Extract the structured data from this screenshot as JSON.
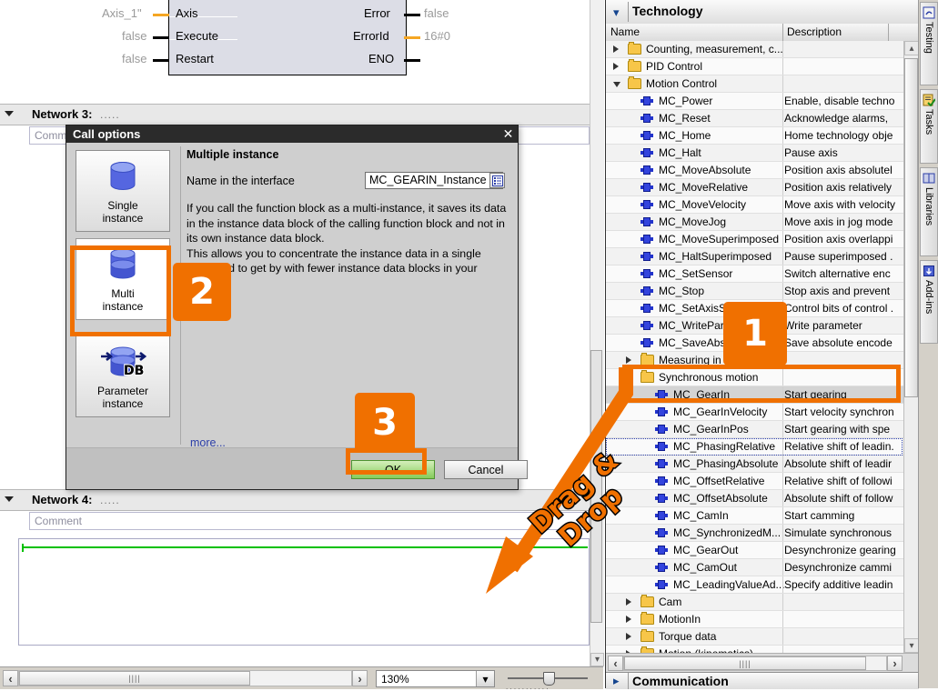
{
  "fbd": {
    "inputs": [
      {
        "value": "Axis_1\"",
        "label": "Axis",
        "wire": "orange"
      },
      {
        "value": "false",
        "label": "Execute",
        "wire": "black"
      },
      {
        "value": "false",
        "label": "Restart",
        "wire": "black"
      }
    ],
    "outputs": [
      {
        "label": "Error",
        "value": "false",
        "wire": "black"
      },
      {
        "label": "ErrorId",
        "value": "16#0",
        "wire": "orange"
      },
      {
        "label": "ENO",
        "value": "",
        "wire": "black"
      }
    ]
  },
  "networks": [
    {
      "title": "Network 3:",
      "dots": "....."
    },
    {
      "title": "Network 4:",
      "dots": ".....",
      "comment": "Comment"
    }
  ],
  "network3_comment": "Comm",
  "dialog": {
    "title": "Call options",
    "close_icon": "close-icon",
    "instance_options": [
      {
        "label_line1": "Single",
        "label_line2": "instance",
        "icon": "single-db-cylinder-icon",
        "selected": false
      },
      {
        "label_line1": "Multi",
        "label_line2": "instance",
        "icon": "multi-db-cylinder-icon",
        "selected": true
      },
      {
        "label_line1": "Parameter",
        "label_line2": "instance",
        "icon": "parameter-db-icon",
        "selected": false
      }
    ],
    "heading": "Multiple instance",
    "name_label": "Name in the interface",
    "name_value": "MC_GEARIN_Instance",
    "name_placeholder": "MC_GEARIN_Instance",
    "name_browse_icon": "list-browse-icon",
    "description": "If you call the function block as a multi-instance, it saves its data in the instance data block of the calling function block and not in its own instance data block.\nThis allows you to concentrate the instance data in a single block and to get by with fewer instance data blocks in your",
    "more_link": "more...",
    "ok_label": "OK",
    "cancel_label": "Cancel"
  },
  "badges": [
    {
      "number": "1"
    },
    {
      "number": "2"
    },
    {
      "number": "3"
    }
  ],
  "annotation": {
    "drag_line1": "Drag &",
    "drag_line2": "Drop",
    "accent_color": "#f07000"
  },
  "toolbar": {
    "zoom_value": "130%",
    "zoom_dropdown_icon": "chevron-down-icon",
    "scroll_left_icon": "chevron-left-icon",
    "scroll_right_icon": "chevron-right-icon"
  },
  "right_panel": {
    "header_title": "Technology",
    "header_chevron": "chevron-down-icon",
    "columns": [
      "Name",
      "Description"
    ],
    "bottom_title": "Communication",
    "bottom_chevron": "chevron-right-icon",
    "rows": [
      {
        "name": "Counting, measurement, c...",
        "desc": "",
        "type": "folder",
        "indent": 0,
        "expander": "closed"
      },
      {
        "name": "PID Control",
        "desc": "",
        "type": "folder",
        "indent": 0,
        "expander": "closed"
      },
      {
        "name": "Motion Control",
        "desc": "",
        "type": "folder",
        "indent": 0,
        "expander": "open"
      },
      {
        "name": "MC_Power",
        "desc": "Enable, disable techno",
        "type": "fb",
        "indent": 1
      },
      {
        "name": "MC_Reset",
        "desc": "Acknowledge alarms,",
        "type": "fb",
        "indent": 1
      },
      {
        "name": "MC_Home",
        "desc": "Home technology obje",
        "type": "fb",
        "indent": 1
      },
      {
        "name": "MC_Halt",
        "desc": "Pause axis",
        "type": "fb",
        "indent": 1
      },
      {
        "name": "MC_MoveAbsolute",
        "desc": "Position axis absolutel",
        "type": "fb",
        "indent": 1
      },
      {
        "name": "MC_MoveRelative",
        "desc": "Position axis relatively",
        "type": "fb",
        "indent": 1
      },
      {
        "name": "MC_MoveVelocity",
        "desc": "Move axis with velocity",
        "type": "fb",
        "indent": 1
      },
      {
        "name": "MC_MoveJog",
        "desc": "Move axis in jog mode",
        "type": "fb",
        "indent": 1
      },
      {
        "name": "MC_MoveSuperimposed",
        "desc": "Position axis overlappi",
        "type": "fb",
        "indent": 1
      },
      {
        "name": "MC_HaltSuperimposed",
        "desc": "Pause superimposed .",
        "type": "fb",
        "indent": 1
      },
      {
        "name": "MC_SetSensor",
        "desc": "Switch alternative enc",
        "type": "fb",
        "indent": 1
      },
      {
        "name": "MC_Stop",
        "desc": "Stop axis and prevent",
        "type": "fb",
        "indent": 1
      },
      {
        "name": "MC_SetAxisS",
        "desc": "Control bits of control .",
        "type": "fb",
        "indent": 1
      },
      {
        "name": "MC_WritePar",
        "desc": "Write parameter",
        "type": "fb",
        "indent": 1
      },
      {
        "name": "MC_SaveAbs",
        "desc": "Save absolute encode",
        "type": "fb",
        "indent": 1
      },
      {
        "name": "Measuring in",
        "desc": "",
        "type": "folder",
        "indent": 1,
        "expander": "closed"
      },
      {
        "name": "Synchronous motion",
        "desc": "",
        "type": "folder",
        "indent": 1,
        "expander": "open"
      },
      {
        "name": "MC_GearIn",
        "desc": "Start gearing",
        "type": "fb",
        "indent": 2,
        "selected": true
      },
      {
        "name": "MC_GearInVelocity",
        "desc": "Start velocity synchron",
        "type": "fb",
        "indent": 2
      },
      {
        "name": "MC_GearInPos",
        "desc": "Start gearing with spe",
        "type": "fb",
        "indent": 2
      },
      {
        "name": "MC_PhasingRelative",
        "desc": "Relative shift of leadin.",
        "type": "fb",
        "indent": 2
      },
      {
        "name": "MC_PhasingAbsolute",
        "desc": "Absolute shift of leadir",
        "type": "fb",
        "indent": 2
      },
      {
        "name": "MC_OffsetRelative",
        "desc": "Relative shift of followi",
        "type": "fb",
        "indent": 2
      },
      {
        "name": "MC_OffsetAbsolute",
        "desc": "Absolute shift of follow",
        "type": "fb",
        "indent": 2
      },
      {
        "name": "MC_CamIn",
        "desc": "Start camming",
        "type": "fb",
        "indent": 2
      },
      {
        "name": "MC_SynchronizedM...",
        "desc": "Simulate synchronous",
        "type": "fb",
        "indent": 2
      },
      {
        "name": "MC_GearOut",
        "desc": "Desynchronize gearing",
        "type": "fb",
        "indent": 2
      },
      {
        "name": "MC_CamOut",
        "desc": "Desynchronize cammi",
        "type": "fb",
        "indent": 2
      },
      {
        "name": "MC_LeadingValueAd...",
        "desc": "Specify additive leadin",
        "type": "fb",
        "indent": 2
      },
      {
        "name": "Cam",
        "desc": "",
        "type": "folder",
        "indent": 1,
        "expander": "closed"
      },
      {
        "name": "MotionIn",
        "desc": "",
        "type": "folder",
        "indent": 1,
        "expander": "closed"
      },
      {
        "name": "Torque data",
        "desc": "",
        "type": "folder",
        "indent": 1,
        "expander": "closed"
      },
      {
        "name": "Motion (kinematics)",
        "desc": "",
        "type": "folder",
        "indent": 1,
        "expander": "closed"
      }
    ]
  },
  "task_cards": [
    {
      "label": "Testing",
      "icon": "testing-icon"
    },
    {
      "label": "Tasks",
      "icon": "tasks-checklist-icon"
    },
    {
      "label": "Libraries",
      "icon": "libraries-book-icon"
    },
    {
      "label": "Add-ins",
      "icon": "addins-icon"
    }
  ]
}
